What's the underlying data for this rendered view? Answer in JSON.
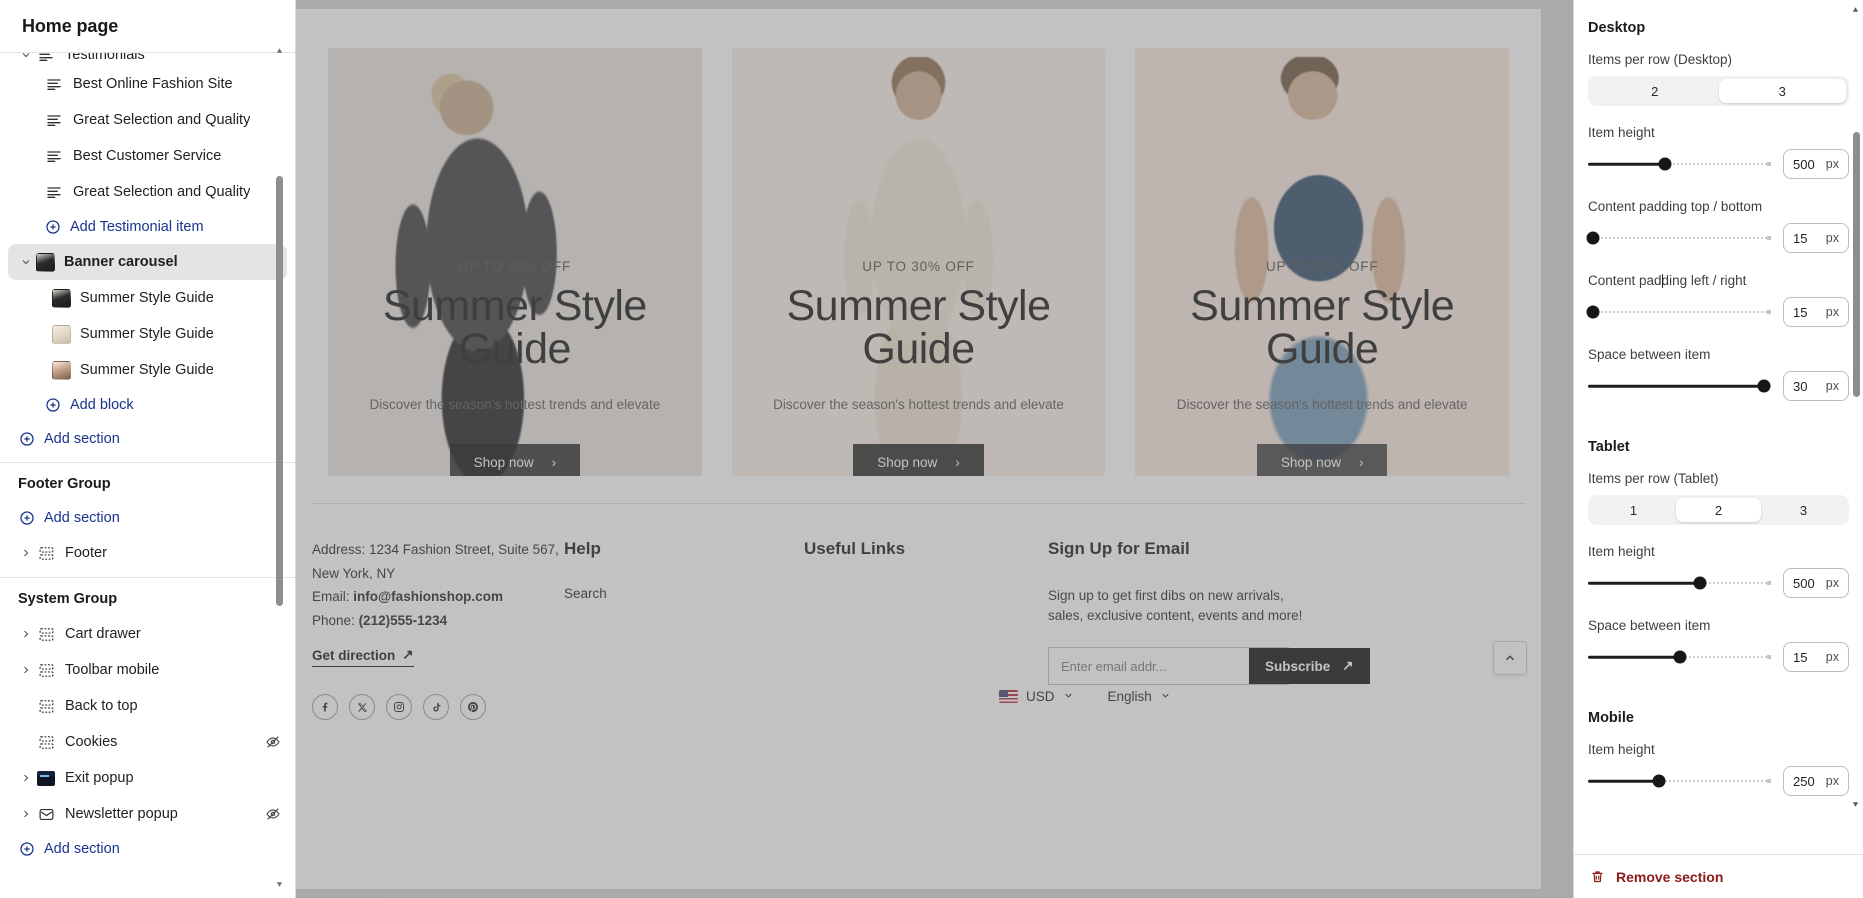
{
  "sidebar": {
    "title": "Home page",
    "items": [
      {
        "kind": "section",
        "level": 0,
        "label": "Testimonials",
        "icon": "text-lines-icon",
        "caret": "down",
        "clipped": true
      },
      {
        "kind": "block",
        "level": 1,
        "label": "Best Online Fashion Site",
        "icon": "text-lines-icon"
      },
      {
        "kind": "block",
        "level": 1,
        "label": "Great Selection and Quality",
        "icon": "text-lines-icon"
      },
      {
        "kind": "block",
        "level": 1,
        "label": "Best Customer Service",
        "icon": "text-lines-icon"
      },
      {
        "kind": "block",
        "level": 1,
        "label": "Great Selection and Quality",
        "icon": "text-lines-icon"
      },
      {
        "kind": "add",
        "level": 1,
        "label": "Add Testimonial item",
        "icon": "plus-circle-icon"
      },
      {
        "kind": "section",
        "level": 0,
        "label": "Banner carousel",
        "icon": "image-thumbnail",
        "caret": "down",
        "selected": true
      },
      {
        "kind": "block",
        "level": 2,
        "label": "Summer Style Guide",
        "icon": "image-thumbnail-1"
      },
      {
        "kind": "block",
        "level": 2,
        "label": "Summer Style Guide",
        "icon": "image-thumbnail-2"
      },
      {
        "kind": "block",
        "level": 2,
        "label": "Summer Style Guide",
        "icon": "image-thumbnail-3"
      },
      {
        "kind": "add",
        "level": 1,
        "label": "Add block",
        "icon": "plus-circle-icon"
      },
      {
        "kind": "add",
        "level": 0,
        "label": "Add section",
        "icon": "plus-circle-icon"
      }
    ],
    "footer_group": {
      "title": "Footer Group",
      "add_label": "Add section",
      "items": [
        {
          "label": "Footer",
          "icon": "section-icon",
          "caret": "right"
        }
      ]
    },
    "system_group": {
      "title": "System Group",
      "add_label": "Add section",
      "items": [
        {
          "label": "Cart drawer",
          "icon": "section-icon",
          "caret": "right",
          "hidden": false
        },
        {
          "label": "Toolbar mobile",
          "icon": "section-icon",
          "caret": "right",
          "hidden": false
        },
        {
          "label": "Back to top",
          "icon": "section-icon",
          "caret": "none",
          "hidden": false
        },
        {
          "label": "Cookies",
          "icon": "section-icon",
          "caret": "none",
          "hidden": true
        },
        {
          "label": "Exit popup",
          "icon": "popup-thumbnail",
          "caret": "right",
          "hidden": false
        },
        {
          "label": "Newsletter popup",
          "icon": "envelope-icon",
          "caret": "right",
          "hidden": true
        }
      ]
    }
  },
  "preview": {
    "cards": [
      {
        "kicker": "UP TO 30% OFF",
        "headline": "Summer Style Guide",
        "sub": "Discover the season's hottest trends and elevate",
        "cta": "Shop now"
      },
      {
        "kicker": "UP TO 30% OFF",
        "headline": "Summer Style Guide",
        "sub": "Discover the season's hottest trends and elevate",
        "cta": "Shop now"
      },
      {
        "kicker": "UP TO 30% OFF",
        "headline": "Summer Style Guide",
        "sub": "Discover the season's hottest trends and elevate",
        "cta": "Shop now"
      }
    ],
    "footer": {
      "address_line1": "Address: 1234 Fashion Street, Suite 567,",
      "address_line2": "New York, NY",
      "email_label": "Email:",
      "email_value": "info@fashionshop.com",
      "phone_label": "Phone:",
      "phone_value": "(212)555-1234",
      "get_direction": "Get direction",
      "socials": [
        "facebook-icon",
        "x-twitter-icon",
        "instagram-icon",
        "tiktok-icon",
        "pinterest-icon"
      ],
      "help_title": "Help",
      "help_links": [
        "Search"
      ],
      "useful_title": "Useful Links",
      "signup_title": "Sign Up for Email",
      "signup_desc_line1": "Sign up to get first dibs on new arrivals,",
      "signup_desc_line2": "sales, exclusive content, events and more!",
      "email_placeholder": "Enter email addr...",
      "subscribe_label": "Subscribe",
      "currency": "USD",
      "language": "English"
    }
  },
  "right_panel": {
    "groups": [
      {
        "title": "Desktop",
        "controls": [
          {
            "type": "segmented",
            "label": "Items per row (Desktop)",
            "options": [
              "2",
              "3"
            ],
            "selected": "3"
          },
          {
            "type": "slider",
            "label": "Item height",
            "value": "500",
            "unit": "px",
            "percent": 42
          },
          {
            "type": "slider",
            "label": "Content padding top / bottom",
            "value": "15",
            "unit": "px",
            "percent": 2
          },
          {
            "type": "slider",
            "label": "Content padding left / right",
            "value": "15",
            "unit": "px",
            "percent": 2
          },
          {
            "type": "slider",
            "label": "Space between item",
            "value": "30",
            "unit": "px",
            "percent": 96
          }
        ]
      },
      {
        "title": "Tablet",
        "controls": [
          {
            "type": "segmented",
            "label": "Items per row (Tablet)",
            "options": [
              "1",
              "2",
              "3"
            ],
            "selected": "2"
          },
          {
            "type": "slider",
            "label": "Item height",
            "value": "500",
            "unit": "px",
            "percent": 61
          },
          {
            "type": "slider",
            "label": "Space between item",
            "value": "15",
            "unit": "px",
            "percent": 50
          }
        ]
      },
      {
        "title": "Mobile",
        "controls": [
          {
            "type": "slider",
            "label": "Item height",
            "value": "250",
            "unit": "px",
            "percent": 39
          }
        ]
      }
    ],
    "remove_section_label": "Remove section"
  },
  "colors": {
    "accent_link": "#19338f",
    "danger": "#8a1b1b",
    "panel_bg": "#ffffff",
    "dim_overlay": "rgba(120,120,120,0.45)"
  }
}
